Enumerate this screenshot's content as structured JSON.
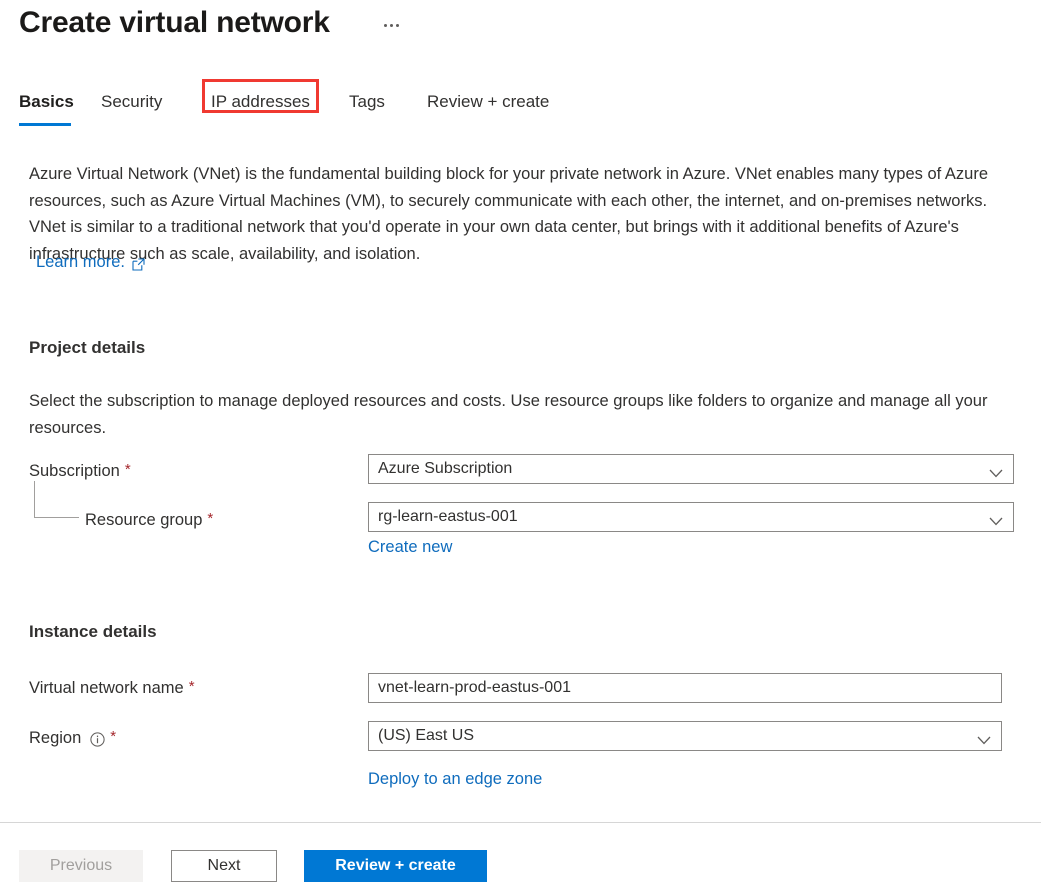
{
  "header": {
    "title": "Create virtual network",
    "more_menu": "…"
  },
  "tabs": [
    {
      "label": "Basics",
      "selected": true,
      "highlighted": false
    },
    {
      "label": "Security",
      "selected": false,
      "highlighted": false
    },
    {
      "label": "IP addresses",
      "selected": false,
      "highlighted": true
    },
    {
      "label": "Tags",
      "selected": false,
      "highlighted": false
    },
    {
      "label": "Review + create",
      "selected": false,
      "highlighted": false
    }
  ],
  "intro": {
    "text": "Azure Virtual Network (VNet) is the fundamental building block for your private network in Azure. VNet enables many types of Azure resources, such as Azure Virtual Machines (VM), to securely communicate with each other, the internet, and on-premises networks. VNet is similar to a traditional network that you'd operate in your own data center, but brings with it additional benefits of Azure's infrastructure such as scale, availability, and isolation.",
    "learn_more": "Learn more."
  },
  "project_details": {
    "title": "Project details",
    "description": "Select the subscription to manage deployed resources and costs. Use resource groups like folders to organize and manage all your resources.",
    "subscription": {
      "label": "Subscription",
      "required": "*",
      "value": "Azure Subscription"
    },
    "resource_group": {
      "label": "Resource group",
      "required": "*",
      "value": "rg-learn-eastus-001",
      "create_new": "Create new"
    }
  },
  "instance_details": {
    "title": "Instance details",
    "vnet_name": {
      "label": "Virtual network name",
      "required": "*",
      "value": "vnet-learn-prod-eastus-001"
    },
    "region": {
      "label": "Region",
      "required": "*",
      "value": "(US) East US",
      "edge_zone_link": "Deploy to an edge zone"
    }
  },
  "footer": {
    "previous": "Previous",
    "next": "Next",
    "review_create": "Review + create"
  },
  "colors": {
    "accent": "#0078d4",
    "link": "#0f6cbd",
    "required": "#a4262c",
    "highlight": "#f03931",
    "border": "#8a8886"
  }
}
